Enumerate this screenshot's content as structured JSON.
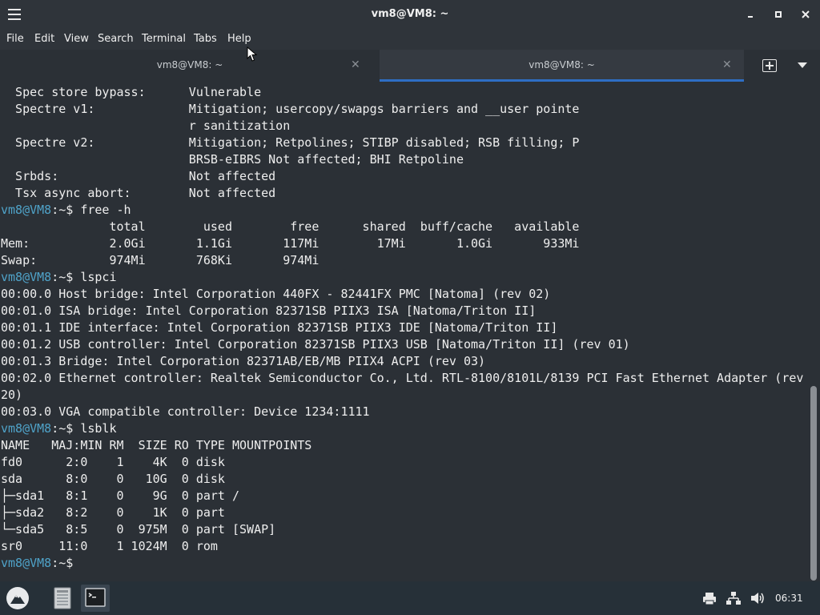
{
  "window": {
    "title": "vm8@VM8: ~",
    "controls": [
      "minimize-icon",
      "maximize-icon",
      "close-icon"
    ]
  },
  "menu": [
    "File",
    "Edit",
    "View",
    "Search",
    "Terminal",
    "Tabs",
    "Help"
  ],
  "tabs": [
    {
      "label": "vm8@VM8: ~",
      "active": false
    },
    {
      "label": "vm8@VM8: ~",
      "active": true
    }
  ],
  "prompt": {
    "user": "vm8@VM8",
    "path": ":~",
    "symbol": "$"
  },
  "terminal_lines": [
    {
      "type": "out",
      "text": "  Spec store bypass:      Vulnerable"
    },
    {
      "type": "out",
      "text": "  Spectre v1:             Mitigation; usercopy/swapgs barriers and __user pointe"
    },
    {
      "type": "out",
      "text": "                          r sanitization"
    },
    {
      "type": "out",
      "text": "  Spectre v2:             Mitigation; Retpolines; STIBP disabled; RSB filling; P"
    },
    {
      "type": "out",
      "text": "                          BRSB-eIBRS Not affected; BHI Retpoline"
    },
    {
      "type": "out",
      "text": "  Srbds:                  Not affected"
    },
    {
      "type": "out",
      "text": "  Tsx async abort:        Not affected"
    },
    {
      "type": "cmd",
      "text": "free -h"
    },
    {
      "type": "out",
      "text": "               total        used        free      shared  buff/cache   available"
    },
    {
      "type": "out",
      "text": "Mem:           2.0Gi       1.1Gi       117Mi        17Mi       1.0Gi       933Mi"
    },
    {
      "type": "out",
      "text": "Swap:          974Mi       768Ki       974Mi"
    },
    {
      "type": "cmd",
      "text": "lspci"
    },
    {
      "type": "out",
      "text": "00:00.0 Host bridge: Intel Corporation 440FX - 82441FX PMC [Natoma] (rev 02)"
    },
    {
      "type": "out",
      "text": "00:01.0 ISA bridge: Intel Corporation 82371SB PIIX3 ISA [Natoma/Triton II]"
    },
    {
      "type": "out",
      "text": "00:01.1 IDE interface: Intel Corporation 82371SB PIIX3 IDE [Natoma/Triton II]"
    },
    {
      "type": "out",
      "text": "00:01.2 USB controller: Intel Corporation 82371SB PIIX3 USB [Natoma/Triton II] (rev 01)"
    },
    {
      "type": "out",
      "text": "00:01.3 Bridge: Intel Corporation 82371AB/EB/MB PIIX4 ACPI (rev 03)"
    },
    {
      "type": "out",
      "text": "00:02.0 Ethernet controller: Realtek Semiconductor Co., Ltd. RTL-8100/8101L/8139 PCI Fast Ethernet Adapter (rev"
    },
    {
      "type": "out",
      "text": "20)"
    },
    {
      "type": "out",
      "text": "00:03.0 VGA compatible controller: Device 1234:1111"
    },
    {
      "type": "cmd",
      "text": "lsblk"
    },
    {
      "type": "out",
      "text": "NAME   MAJ:MIN RM  SIZE RO TYPE MOUNTPOINTS"
    },
    {
      "type": "out",
      "text": "fd0      2:0    1    4K  0 disk"
    },
    {
      "type": "out",
      "text": "sda      8:0    0   10G  0 disk"
    },
    {
      "type": "out",
      "text": "├─sda1   8:1    0    9G  0 part /"
    },
    {
      "type": "out",
      "text": "├─sda2   8:2    0    1K  0 part"
    },
    {
      "type": "out",
      "text": "└─sda5   8:5    0  975M  0 part [SWAP]"
    },
    {
      "type": "out",
      "text": "sr0     11:0    1 1024M  0 rom"
    },
    {
      "type": "cmd",
      "text": ""
    }
  ],
  "taskbar": {
    "launcher_icon": "mountain-icon",
    "tasks": [
      {
        "icon": "file-manager-icon",
        "active": false
      },
      {
        "icon": "terminal-icon",
        "active": true
      }
    ],
    "tray": [
      "printer-icon",
      "network-icon",
      "volume-icon"
    ],
    "clock": "06:31"
  },
  "colors": {
    "prompt_user": "#4fa3c9",
    "accent": "#2e6ec4",
    "background": "#2b3036"
  }
}
